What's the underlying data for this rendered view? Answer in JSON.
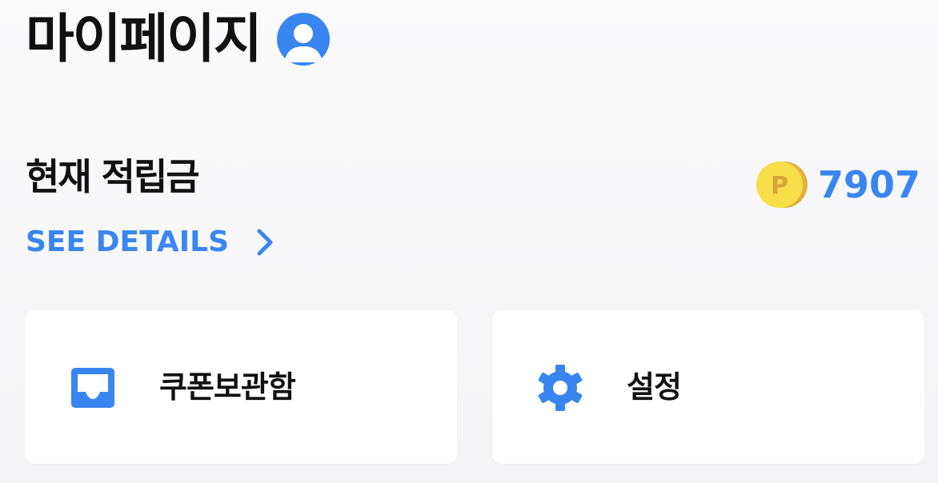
{
  "page": {
    "title": "마이페이지",
    "avatar_icon": "user-avatar-icon"
  },
  "points": {
    "label": "현재 적립금",
    "details_link": "SEE DETAILS",
    "coin_letter": "P",
    "value": "7907"
  },
  "menu": [
    {
      "label": "쿠폰보관함",
      "icon": "coupon-box-icon"
    },
    {
      "label": "설정",
      "icon": "gear-icon"
    }
  ],
  "colors": {
    "accent": "#3a86f0",
    "coin_front": "#f6df4a",
    "coin_back": "#e3b23c",
    "coin_letter": "#d9a63b",
    "text": "#111111",
    "background": "#f5f5f7",
    "card": "#ffffff"
  }
}
